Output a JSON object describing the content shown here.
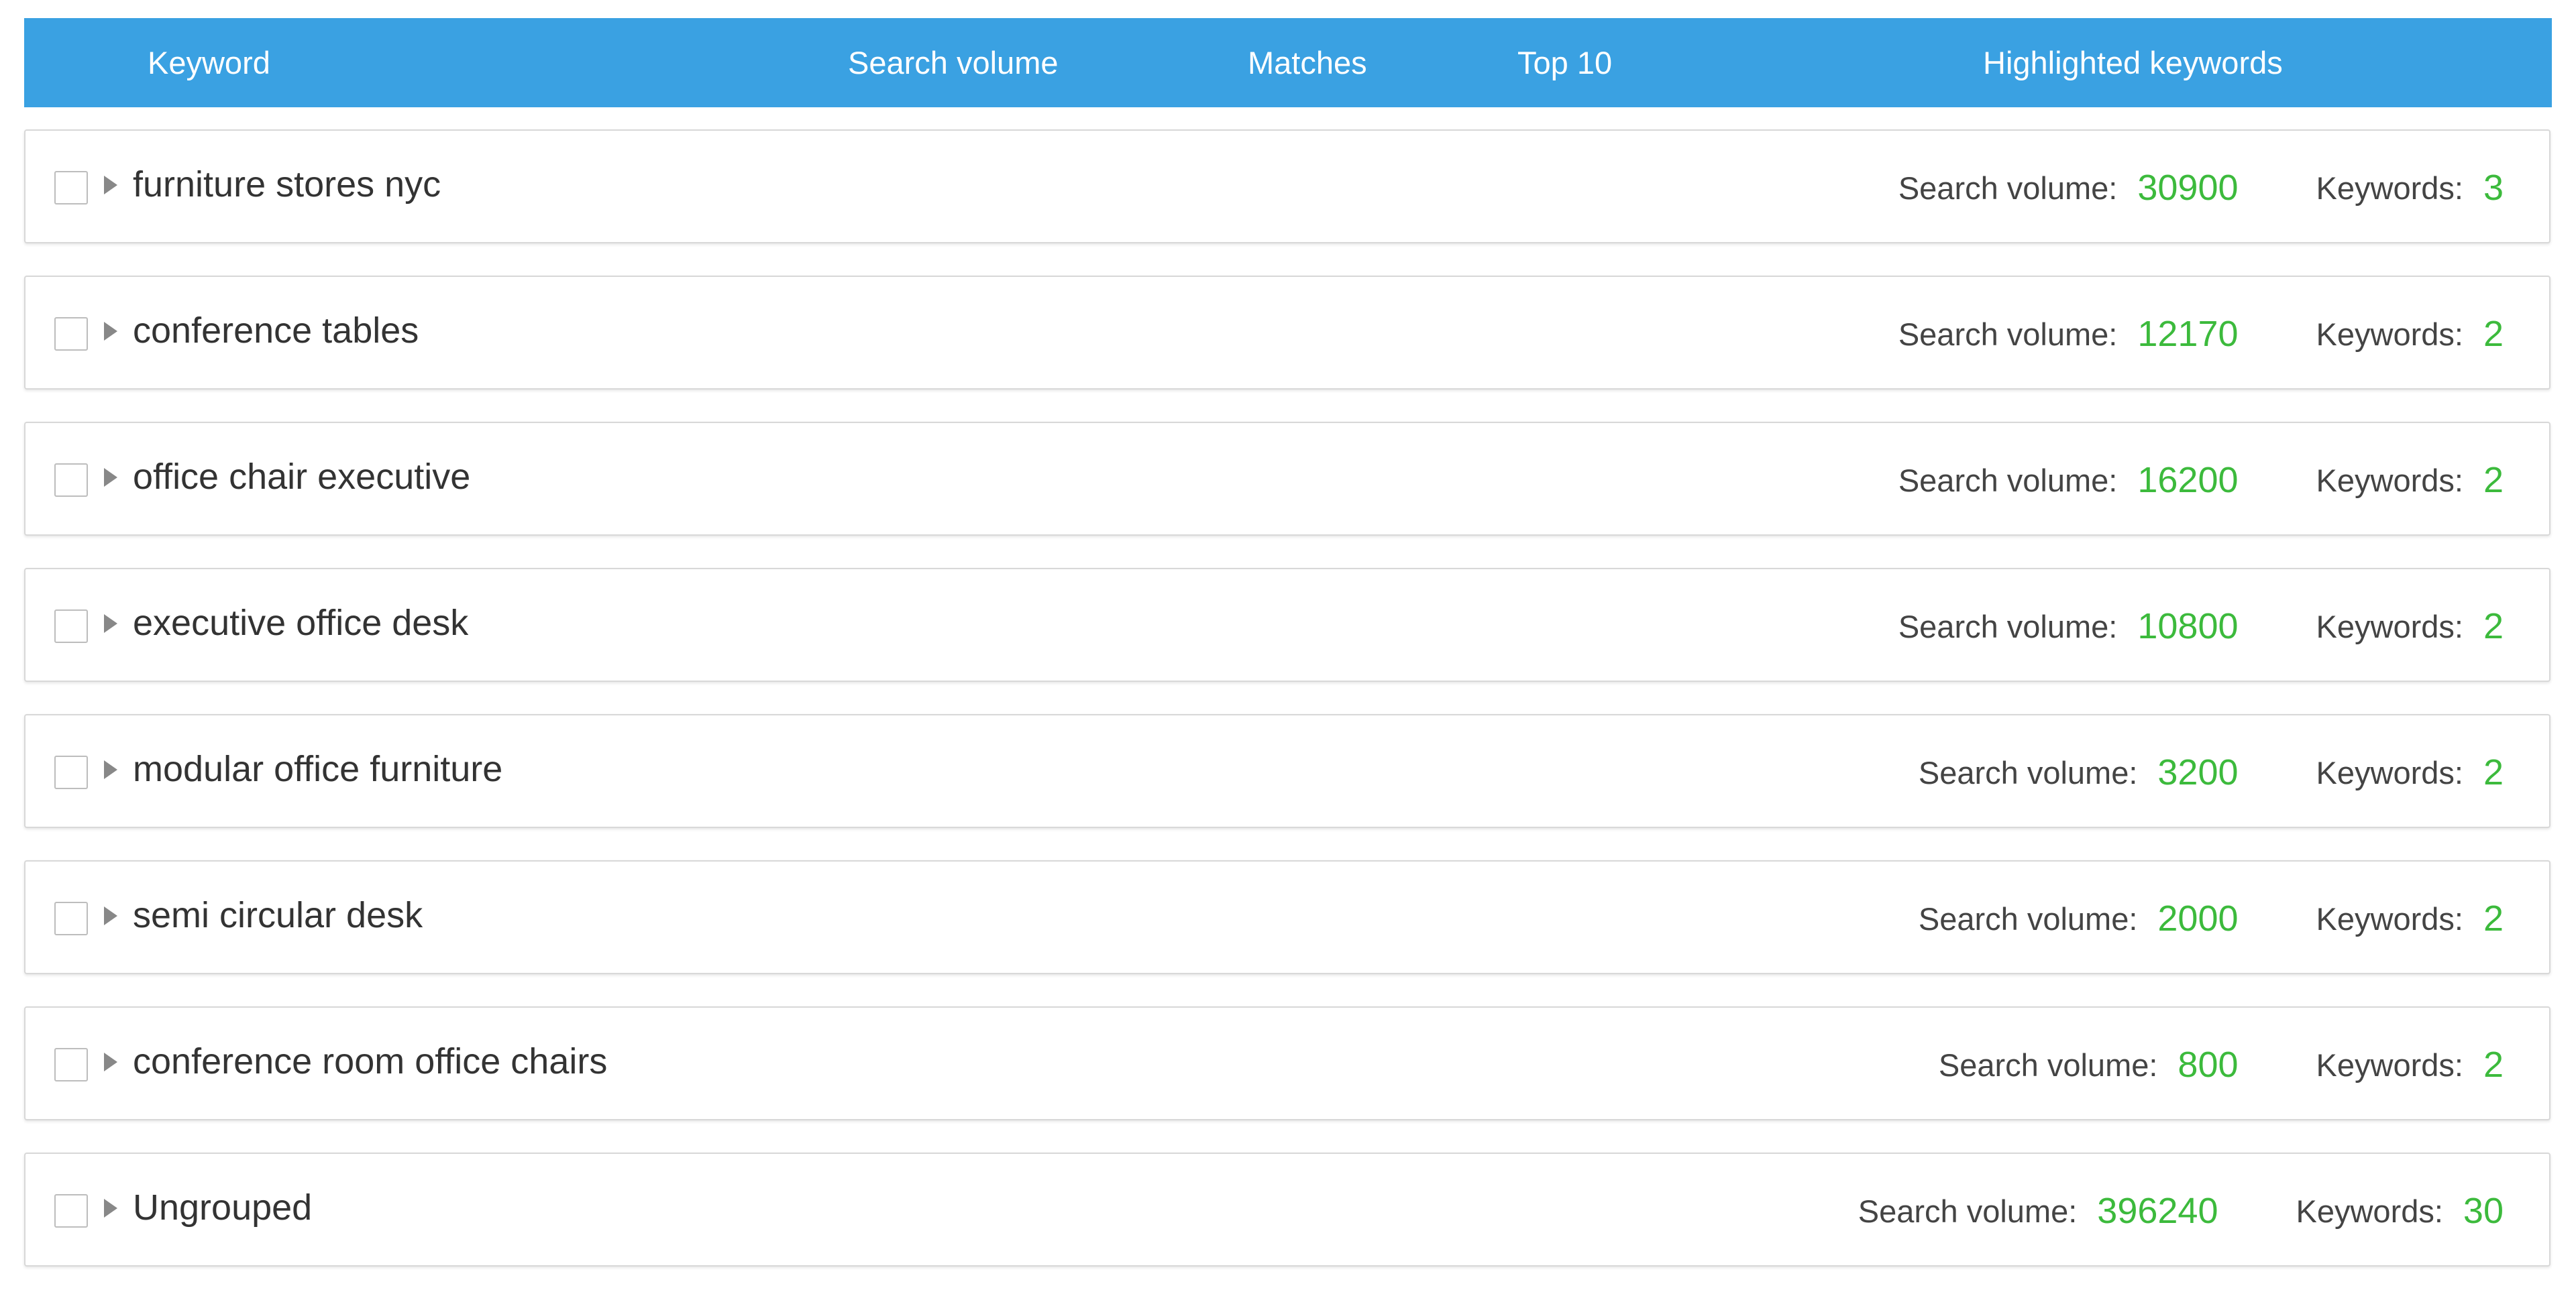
{
  "header": {
    "keyword": "Keyword",
    "search_volume": "Search volume",
    "matches": "Matches",
    "top10": "Top 10",
    "highlighted": "Highlighted keywords"
  },
  "labels": {
    "search_volume": "Search volume:",
    "keywords": "Keywords:"
  },
  "colors": {
    "header_bg": "#3aa1e2",
    "value_green": "#3cba3c"
  },
  "groups": [
    {
      "name": "furniture stores nyc",
      "search_volume": "30900",
      "keywords": "3"
    },
    {
      "name": "conference tables",
      "search_volume": "12170",
      "keywords": "2"
    },
    {
      "name": "office chair executive",
      "search_volume": "16200",
      "keywords": "2"
    },
    {
      "name": "executive office desk",
      "search_volume": "10800",
      "keywords": "2"
    },
    {
      "name": "modular office furniture",
      "search_volume": "3200",
      "keywords": "2"
    },
    {
      "name": "semi circular desk",
      "search_volume": "2000",
      "keywords": "2"
    },
    {
      "name": "conference room office chairs",
      "search_volume": "800",
      "keywords": "2"
    },
    {
      "name": "Ungrouped",
      "search_volume": "396240",
      "keywords": "30"
    }
  ]
}
